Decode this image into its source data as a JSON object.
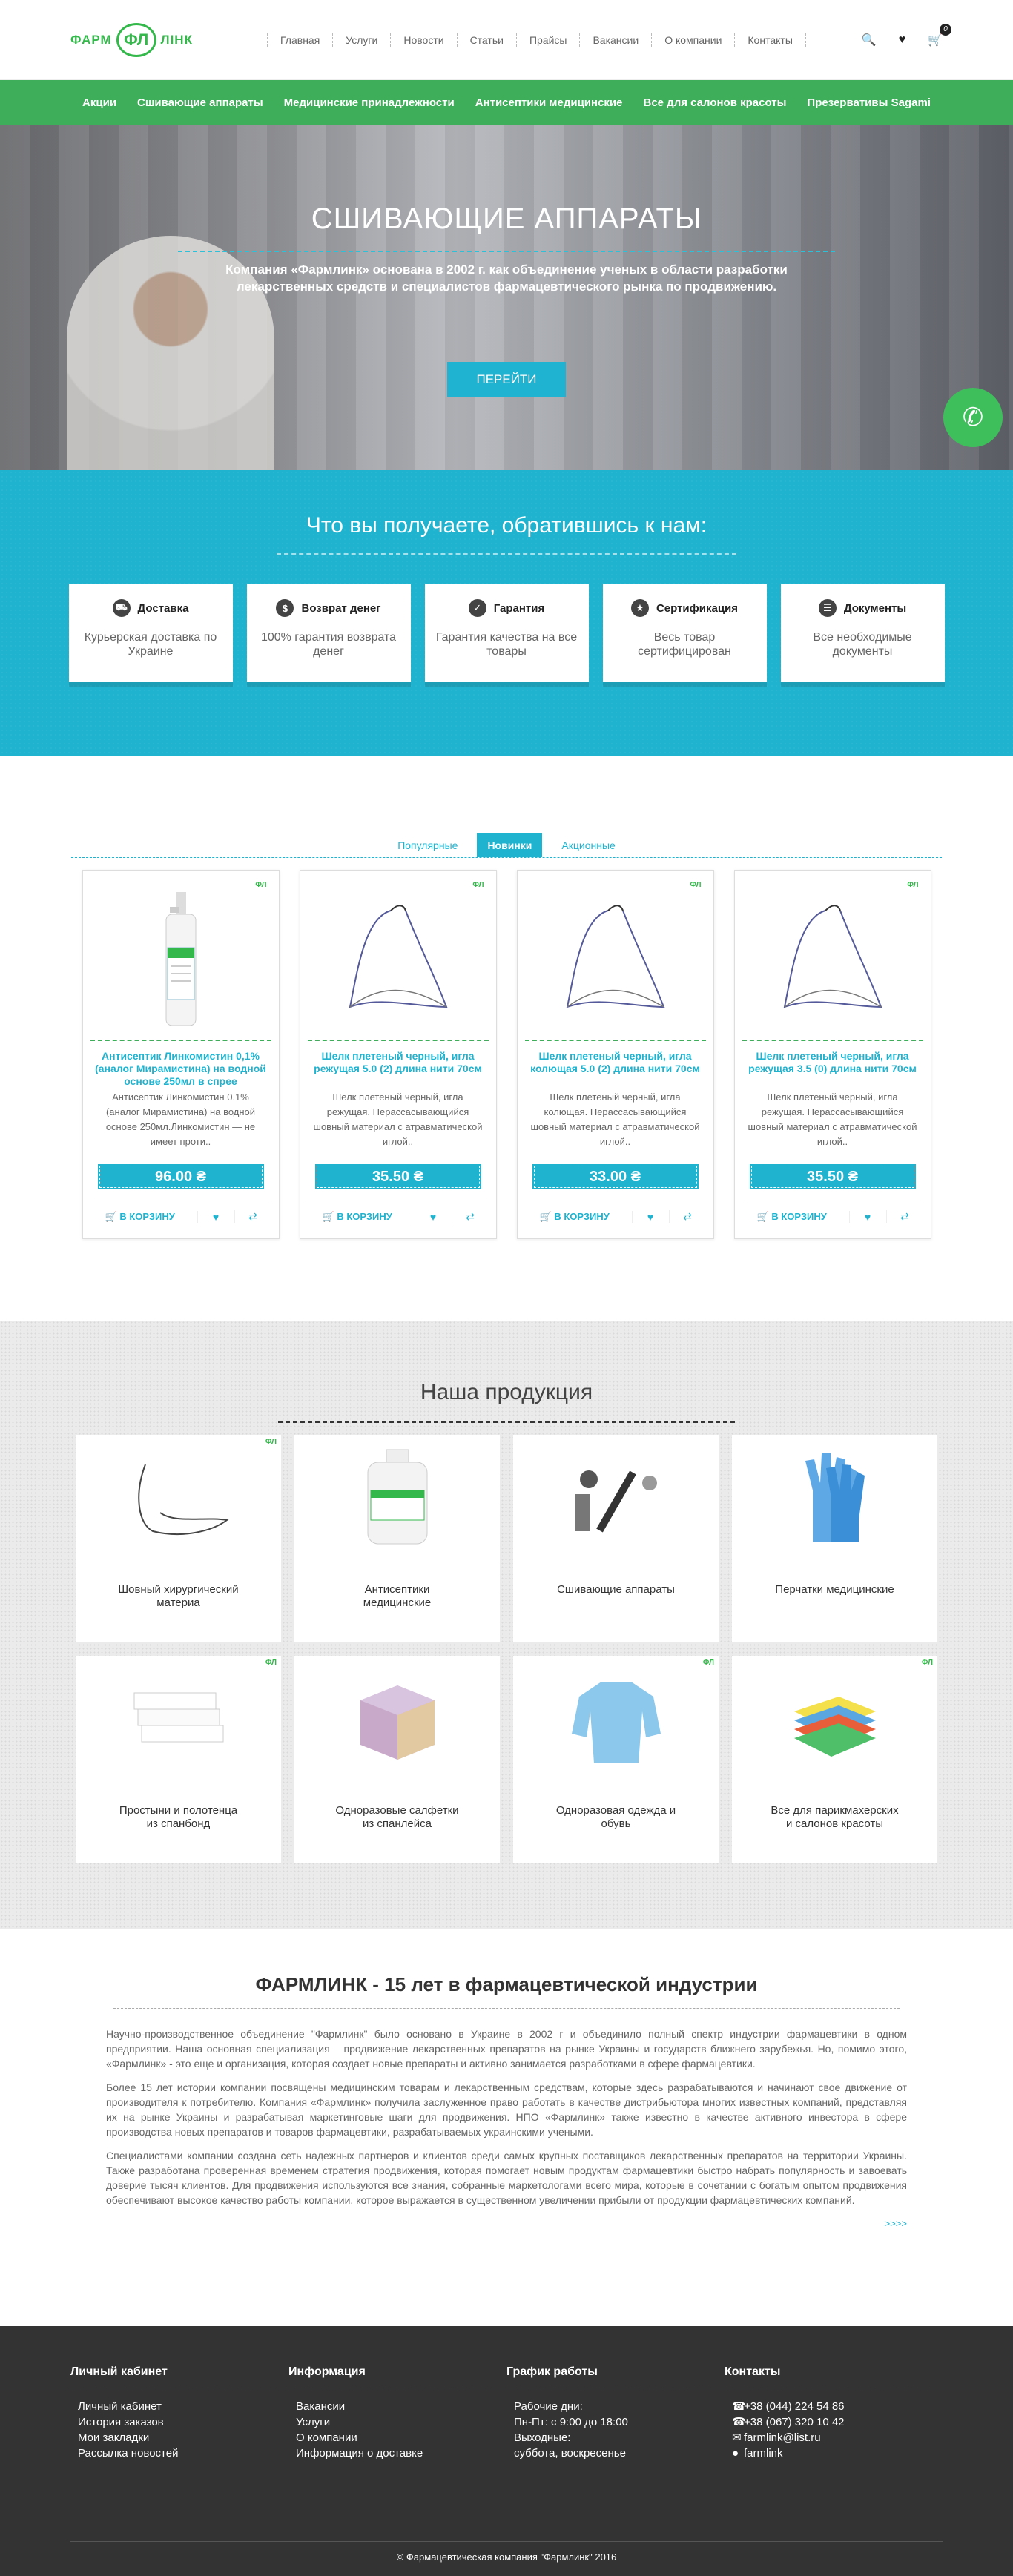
{
  "header": {
    "logo_left": "ФАРМ",
    "logo_mark": "ФЛ",
    "logo_right": "ЛІНК",
    "nav": [
      "Главная",
      "Услуги",
      "Новости",
      "Статьи",
      "Прайсы",
      "Вакансии",
      "О компании",
      "Контакты"
    ],
    "cart_count": "0"
  },
  "catbar": [
    "Акции",
    "Сшивающие аппараты",
    "Медицинские принадлежности",
    "Антисептики медицинские",
    "Все для салонов красоты",
    "Презервативы Sagami"
  ],
  "hero": {
    "title": "СШИВАЮЩИЕ АППАРАТЫ",
    "text": "Компания «Фармлинк» основана в 2002 г. как объединение ученых в области разработки лекарственных средств и специалистов фармацевтического рынка по продвижению.",
    "button": "ПЕРЕЙТИ"
  },
  "benefits": {
    "title": "Что вы получаете, обратившись к нам:",
    "items": [
      {
        "label": "Доставка",
        "text": "Курьерская доставка по Украине",
        "icon": "truck-icon"
      },
      {
        "label": "Возврат денег",
        "text": "100% гарантия возврата денег",
        "icon": "money-bag-icon"
      },
      {
        "label": "Гарантия",
        "text": "Гарантия качества на все товары",
        "icon": "shield-icon"
      },
      {
        "label": "Сертификация",
        "text": "Весь товар сертифицирован",
        "icon": "certificate-icon"
      },
      {
        "label": "Документы",
        "text": "Все необходимые документы",
        "icon": "document-icon"
      }
    ]
  },
  "products": {
    "tabs": [
      "Популярные",
      "Новинки",
      "Акционные"
    ],
    "cart_label": "В КОРЗИНУ",
    "items": [
      {
        "name": "Антисептик Линкомистин 0,1% (аналог Мирамистина) на водной основе 250мл в спрее",
        "desc": "Антисептик Линкомистин 0.1% (аналог Мирамистина) на водной основе 250мл.Линкомистин — не имеет проти..",
        "price": "96.00 ₴",
        "image": "spray-bottle"
      },
      {
        "name": "Шелк плетеный черный, игла режущая 5.0 (2) длина нити 70см",
        "desc": "Шелк плетеный черный, игла режущая. Нерассасывающийся шовный материал с атравматической иглой..",
        "price": "35.50 ₴",
        "image": "suture"
      },
      {
        "name": "Шелк плетеный черный, игла колющая 5.0 (2) длина нити 70см",
        "desc": "Шелк плетеный черный, игла колющая. Нерассасывающийся шовный материал с атравматической иглой..",
        "price": "33.00 ₴",
        "image": "suture"
      },
      {
        "name": "Шелк плетеный черный, игла режущая 3.5 (0) длина нити 70см",
        "desc": "Шелк плетеный черный, игла режущая. Нерассасывающийся шовный материал с атравматической иглой..",
        "price": "35.50 ₴",
        "image": "suture"
      }
    ]
  },
  "ourprod": {
    "title": "Наша продукция",
    "items": [
      {
        "name": "Шовный хирургический материа",
        "image": "suture"
      },
      {
        "name": "Антисептики медицинские",
        "image": "antiseptic-jar"
      },
      {
        "name": "Сшивающие аппараты",
        "image": "stapler"
      },
      {
        "name": "Перчатки медицинские",
        "image": "gloves"
      },
      {
        "name": "Простыни и полотенца из спанбонд",
        "image": "towels"
      },
      {
        "name": "Одноразовые салфетки из спанлейса",
        "image": "napkins"
      },
      {
        "name": "Одноразовая одежда и обувь",
        "image": "gown"
      },
      {
        "name": "Все для парикмахерских и салонов красоты",
        "image": "capes"
      }
    ]
  },
  "about": {
    "title": "ФАРМЛИНК - 15 лет в фармацевтической индустрии",
    "p1": "Научно-производственное объединение \"Фармлинк\" было основано в Украине в 2002 г и объединило полный спектр индустрии фармацевтики в одном предприятии. Наша основная специализация – продвижение лекарственных препаратов на рынке Украины и государств ближнего зарубежья. Но, помимо этого, «Фармлинк» - это еще и организация, которая создает новые препараты и активно занимается разработками в сфере фармацевтики.",
    "p2": "Более 15 лет истории компании посвящены медицинским товарам и лекарственным средствам, которые здесь разрабатываются и начинают свое движение от производителя к потребителю. Компания «Фармлинк» получила заслуженное право работать в качестве дистрибьютора многих известных компаний, представляя их на рынке Украины и разрабатывая маркетинговые шаги для продвижения. НПО «Фармлинк» также известно в качестве активного инвестора в сфере производства новых препаратов и товаров фармацевтики, разрабатываемых украинскими учеными.",
    "p3": "Специалистами компании создана сеть надежных партнеров и клиентов среди самых крупных поставщиков лекарственных препаратов на территории Украины. Также разработана проверенная временем стратегия продвижения, которая помогает новым продуктам фармацевтики быстро набрать популярность и завоевать доверие тысяч клиентов. Для продвижения используются все знания, собранные маркетологами всего мира, которые в сочетании с богатым опытом продвижения обеспечивают высокое качество работы компании, которое выражается в существенном увеличении прибыли от продукции фармацевтических компаний.",
    "more": ">>>>"
  },
  "footer": {
    "cols": [
      {
        "title": "Личный кабинет",
        "items": [
          "Личный кабинет",
          "История заказов",
          "Мои закладки",
          "Рассылка новостей"
        ]
      },
      {
        "title": "Информация",
        "items": [
          "Вакансии",
          "Услуги",
          "О компании",
          "Информация о доставке"
        ]
      },
      {
        "title": "График работы",
        "items": [
          "Рабочие дни:",
          "Пн-Пт: с 9:00 до 18:00",
          "Выходные:",
          "суббота, воскресенье"
        ]
      },
      {
        "title": "Контакты",
        "items": [
          "+38 (044) 224 54 86",
          "+38 (067) 320 10 42",
          "farmlink@list.ru",
          "farmlink"
        ]
      }
    ],
    "copyright": "© Фармацевтическая компания \"Фармлинк\" 2016"
  },
  "colors": {
    "accent": "#1fb3cf",
    "green": "#3fae5a",
    "footer": "#333333"
  }
}
